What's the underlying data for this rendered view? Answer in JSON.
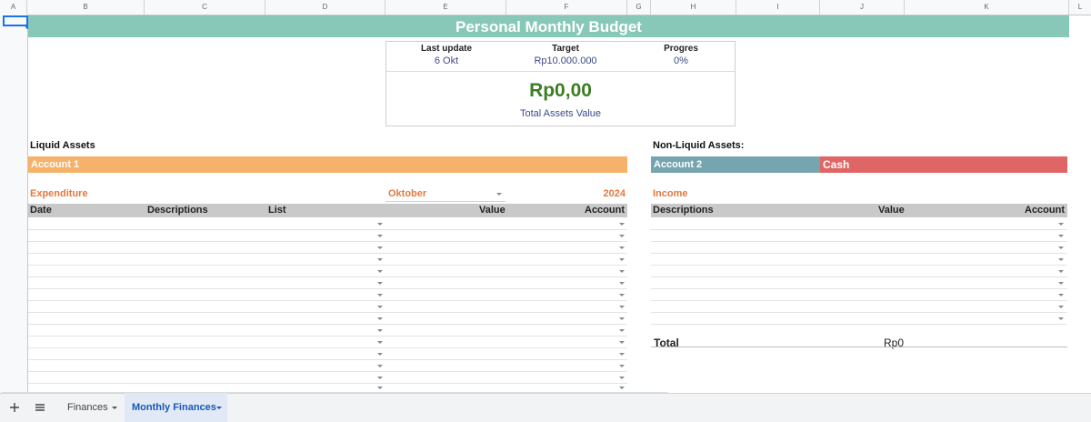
{
  "columns": [
    "A",
    "B",
    "C",
    "D",
    "E",
    "F",
    "G",
    "H",
    "I",
    "J",
    "K",
    "L"
  ],
  "title": "Personal Monthly Budget",
  "summary": {
    "last_update_label": "Last update",
    "last_update_value": "6 Okt",
    "target_label": "Target",
    "target_value": "Rp10.000.000",
    "progress_label": "Progres",
    "progress_value": "0%",
    "total_value": "Rp0,00",
    "total_label": "Total Assets Value"
  },
  "liquid": {
    "heading": "Liquid Assets",
    "account": "Account 1",
    "account_color": "#f6b26b"
  },
  "non_liquid": {
    "heading": "Non-Liquid Assets:",
    "account2": "Account 2",
    "account2_color": "#76a5af",
    "cash": "Cash",
    "cash_color": "#e06666"
  },
  "expenditure": {
    "label": "Expenditure",
    "month": "Oktober",
    "year": "2024",
    "headers": {
      "date": "Date",
      "desc": "Descriptions",
      "list": "List",
      "value": "Value",
      "account": "Account"
    }
  },
  "income": {
    "label": "Income",
    "headers": {
      "desc": "Descriptions",
      "value": "Value",
      "account": "Account"
    },
    "total_label": "Total",
    "total_value": "Rp0"
  },
  "toolbar": {
    "add_icon": "plus-icon",
    "menu_icon": "menu-icon"
  },
  "sheets": {
    "tab1": "Finances",
    "tab2": "Monthly Finances",
    "active_color": "#1a56b5"
  }
}
